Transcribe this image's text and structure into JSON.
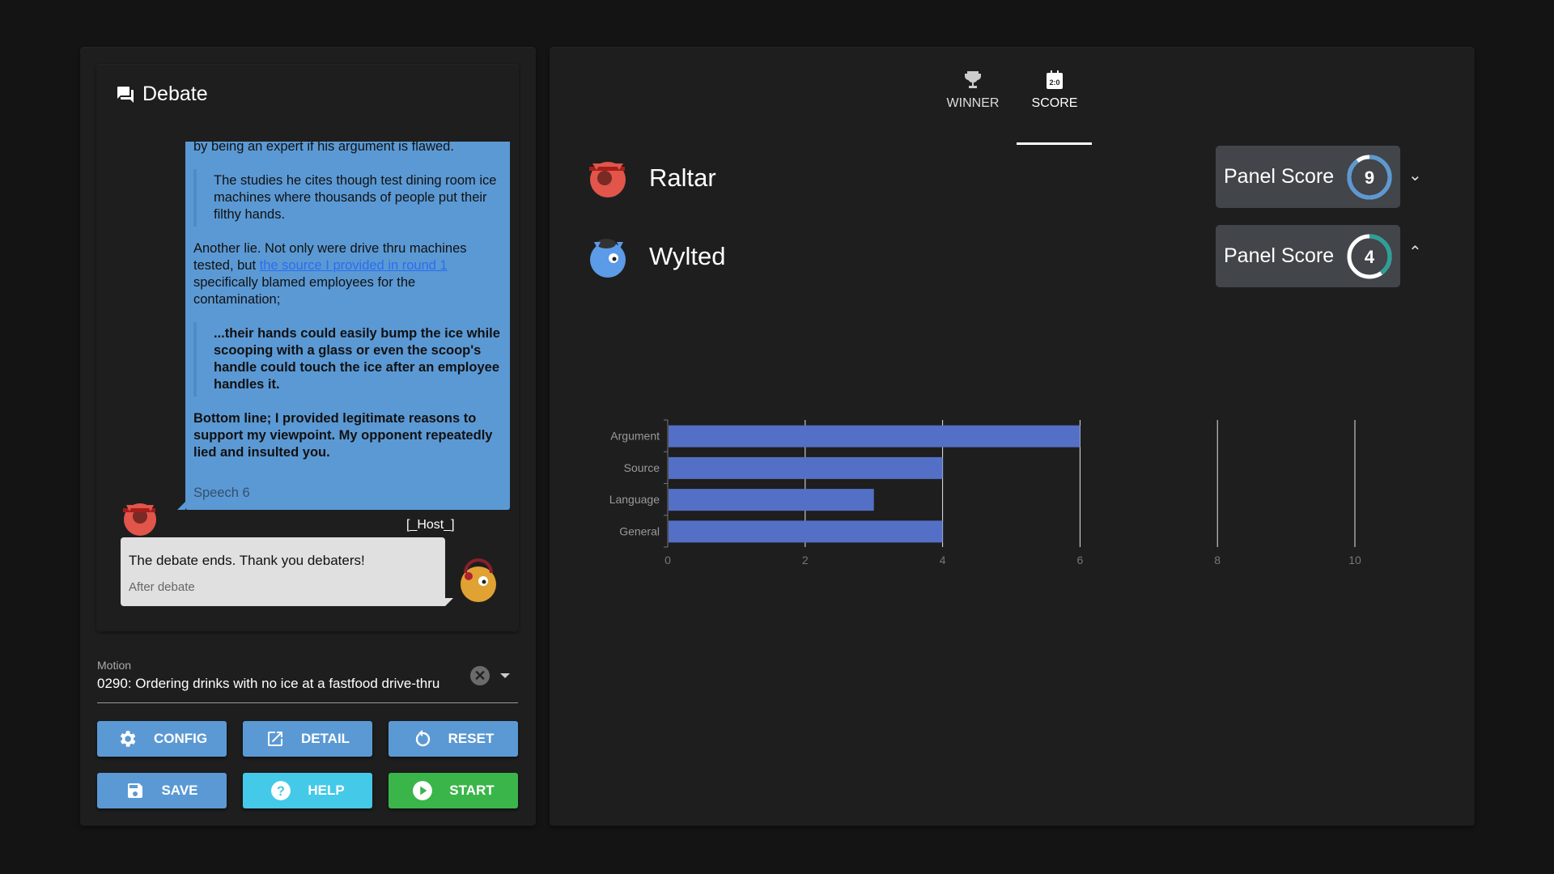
{
  "debate": {
    "title": "Debate",
    "speech": {
      "top_line": "by being an expert if his argument is flawed.",
      "quote1": "The studies he cites though test dining room ice machines where thousands of people put their filthy hands.",
      "p1_before": "Another lie. Not only were drive thru machines tested, but ",
      "p1_link": "the source I provided in round 1",
      "p1_after": " specifically blamed employees for the contamination;",
      "quote2": "...their hands could easily bump the ice while scooping with a glass or even the scoop's handle could touch the ice after an employee handles it.",
      "p2": "Bottom line; I provided legitimate reasons to support my viewpoint. My opponent repeatedly lied and insulted you.",
      "meta": "Speech 6"
    },
    "host": {
      "label": "[_Host_]",
      "text": "The debate ends. Thank you debaters!",
      "meta": "After debate"
    }
  },
  "motion": {
    "label": "Motion",
    "value": "0290: Ordering drinks with no ice at a fastfood drive-thru"
  },
  "buttons": {
    "config": "CONFIG",
    "detail": "DETAIL",
    "reset": "RESET",
    "save": "SAVE",
    "help": "HELP",
    "start": "START"
  },
  "colors": {
    "primary": "#5b99d4",
    "help": "#45c9e8",
    "start": "#3ab54a",
    "bar": "#5470c6"
  },
  "tabs": [
    {
      "label": "WINNER",
      "icon": "trophy-icon"
    },
    {
      "label": "SCORE",
      "icon": "scoreboard-icon",
      "active": true
    }
  ],
  "players": [
    {
      "name": "Raltar",
      "score_label": "Panel Score",
      "score": "9",
      "expanded": false
    },
    {
      "name": "Wylted",
      "score_label": "Panel Score",
      "score": "4",
      "expanded": true
    }
  ],
  "chart_data": {
    "type": "bar",
    "orientation": "horizontal",
    "categories": [
      "Argument",
      "Source",
      "Language",
      "General"
    ],
    "values": [
      6,
      4,
      3,
      4
    ],
    "xlim": [
      0,
      10
    ],
    "xticks": [
      "0",
      "2",
      "4",
      "6",
      "8",
      "10"
    ],
    "grid": true
  }
}
